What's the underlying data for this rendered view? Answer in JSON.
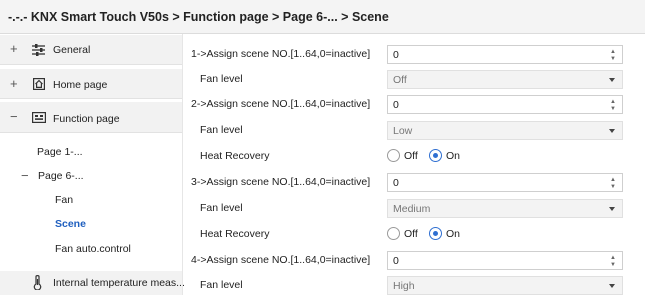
{
  "breadcrumb": "-.-.- KNX Smart Touch V50s > Function page > Page 6-... > Scene",
  "sidebar": {
    "general": {
      "toggle": "+",
      "label": "General",
      "icon": "sliders-icon"
    },
    "home_page": {
      "toggle": "+",
      "label": "Home page",
      "icon": "home-icon"
    },
    "function_page": {
      "toggle": "−",
      "label": "Function page",
      "icon": "keyboard-icon"
    },
    "page1": {
      "label": "Page 1-..."
    },
    "page6": {
      "toggle": "−",
      "label": "Page 6-..."
    },
    "fan": {
      "label": "Fan"
    },
    "scene": {
      "label": "Scene"
    },
    "fan_auto": {
      "label": "Fan auto.control"
    },
    "internal_temp": {
      "label": "Internal temperature meas...",
      "icon": "thermometer-icon"
    }
  },
  "content": {
    "row1": {
      "label": "1->Assign scene NO.[1..64,0=inactive]",
      "value": "0"
    },
    "row2": {
      "label": "Fan level",
      "value": "Off"
    },
    "row3": {
      "label": "2->Assign scene NO.[1..64,0=inactive]",
      "value": "0"
    },
    "row4": {
      "label": "Fan level",
      "value": "Low"
    },
    "row5": {
      "label": "Heat Recovery",
      "opt_off": "Off",
      "opt_on": "On",
      "selected": "On"
    },
    "row6": {
      "label": "3->Assign scene NO.[1..64,0=inactive]",
      "value": "0"
    },
    "row7": {
      "label": "Fan level",
      "value": "Medium"
    },
    "row8": {
      "label": "Heat Recovery",
      "opt_off": "Off",
      "opt_on": "On",
      "selected": "On"
    },
    "row9": {
      "label": "4->Assign scene NO.[1..64,0=inactive]",
      "value": "0"
    },
    "row10": {
      "label": "Fan level",
      "value": "High"
    }
  },
  "colors": {
    "accent": "#2f6fd1",
    "selected_text": "#1f5fbf"
  }
}
